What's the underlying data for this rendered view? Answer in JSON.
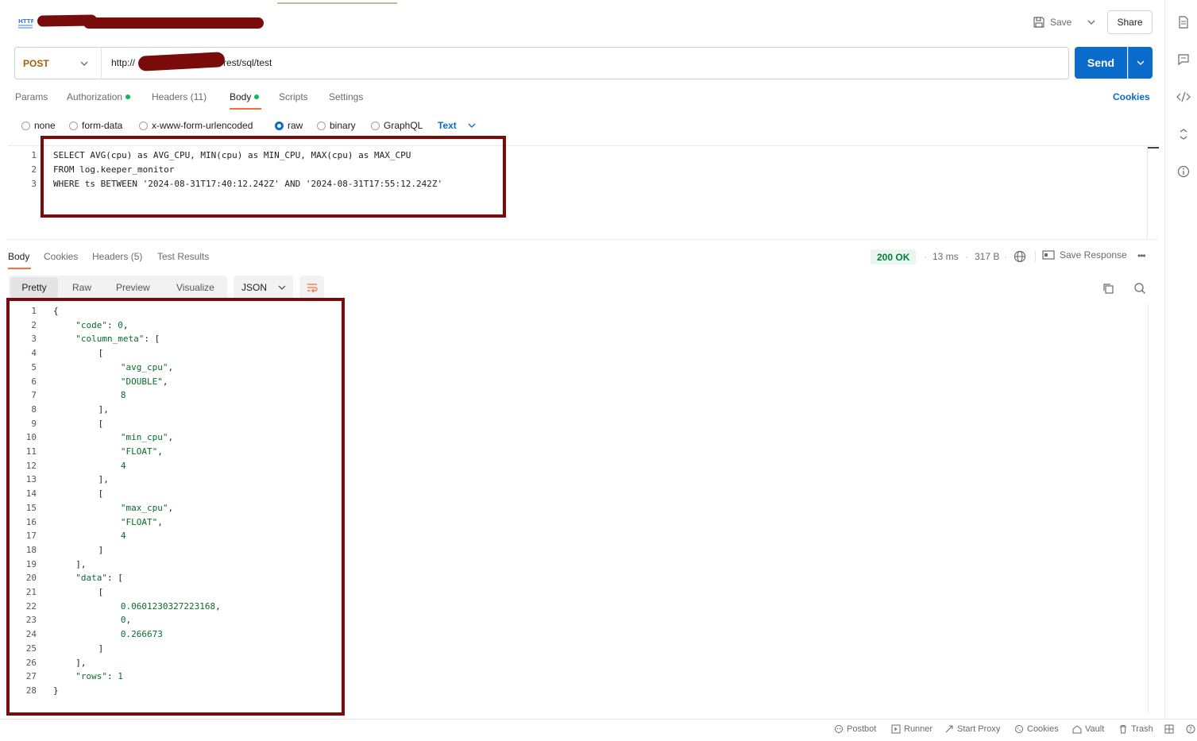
{
  "header": {
    "title_icon": "http-icon",
    "save_label": "Save",
    "share_label": "Share"
  },
  "request": {
    "method": "POST",
    "url_prefix": "http://",
    "url_suffix": "rest/sql/test",
    "send_label": "Send",
    "tabs": [
      {
        "label": "Params"
      },
      {
        "label": "Authorization"
      },
      {
        "label": "Headers (11)"
      },
      {
        "label": "Body"
      },
      {
        "label": "Scripts"
      },
      {
        "label": "Settings"
      }
    ],
    "cookies_label": "Cookies",
    "body_types": [
      {
        "label": "none"
      },
      {
        "label": "form-data"
      },
      {
        "label": "x-www-form-urlencoded"
      },
      {
        "label": "raw"
      },
      {
        "label": "binary"
      },
      {
        "label": "GraphQL"
      }
    ],
    "body_format": "Text",
    "code_lines": [
      {
        "n": "1",
        "text": "SELECT AVG(cpu) as AVG_CPU, MIN(cpu) as MIN_CPU, MAX(cpu) as MAX_CPU"
      },
      {
        "n": "2",
        "text": "FROM log.keeper_monitor"
      },
      {
        "n": "3",
        "text": "WHERE ts BETWEEN '2024-08-31T17:40:12.242Z' AND '2024-08-31T17:55:12.242Z'"
      }
    ]
  },
  "response": {
    "tabs": [
      {
        "label": "Body"
      },
      {
        "label": "Cookies"
      },
      {
        "label": "Headers (5)"
      },
      {
        "label": "Test Results"
      }
    ],
    "status": "200 OK",
    "time": "13 ms",
    "size": "317 B",
    "save_response_label": "Save Response",
    "views": [
      {
        "label": "Pretty"
      },
      {
        "label": "Raw"
      },
      {
        "label": "Preview"
      },
      {
        "label": "Visualize"
      }
    ],
    "format": "JSON",
    "lines": [
      {
        "n": "1",
        "indent": 0,
        "key": "",
        "punct": "{",
        "val": ""
      },
      {
        "n": "2",
        "indent": 1,
        "key": "\"code\"",
        "punct": ": ",
        "val": "0",
        "tail": ","
      },
      {
        "n": "3",
        "indent": 1,
        "key": "\"column_meta\"",
        "punct": ": [",
        "val": ""
      },
      {
        "n": "4",
        "indent": 2,
        "key": "",
        "punct": "[",
        "val": ""
      },
      {
        "n": "5",
        "indent": 3,
        "key": "",
        "punct": "",
        "val": "\"avg_cpu\"",
        "tail": ","
      },
      {
        "n": "6",
        "indent": 3,
        "key": "",
        "punct": "",
        "val": "\"DOUBLE\"",
        "tail": ","
      },
      {
        "n": "7",
        "indent": 3,
        "key": "",
        "punct": "",
        "val": "8"
      },
      {
        "n": "8",
        "indent": 2,
        "key": "",
        "punct": "],",
        "val": ""
      },
      {
        "n": "9",
        "indent": 2,
        "key": "",
        "punct": "[",
        "val": ""
      },
      {
        "n": "10",
        "indent": 3,
        "key": "",
        "punct": "",
        "val": "\"min_cpu\"",
        "tail": ","
      },
      {
        "n": "11",
        "indent": 3,
        "key": "",
        "punct": "",
        "val": "\"FLOAT\"",
        "tail": ","
      },
      {
        "n": "12",
        "indent": 3,
        "key": "",
        "punct": "",
        "val": "4"
      },
      {
        "n": "13",
        "indent": 2,
        "key": "",
        "punct": "],",
        "val": ""
      },
      {
        "n": "14",
        "indent": 2,
        "key": "",
        "punct": "[",
        "val": ""
      },
      {
        "n": "15",
        "indent": 3,
        "key": "",
        "punct": "",
        "val": "\"max_cpu\"",
        "tail": ","
      },
      {
        "n": "16",
        "indent": 3,
        "key": "",
        "punct": "",
        "val": "\"FLOAT\"",
        "tail": ","
      },
      {
        "n": "17",
        "indent": 3,
        "key": "",
        "punct": "",
        "val": "4"
      },
      {
        "n": "18",
        "indent": 2,
        "key": "",
        "punct": "]",
        "val": ""
      },
      {
        "n": "19",
        "indent": 1,
        "key": "",
        "punct": "],",
        "val": ""
      },
      {
        "n": "20",
        "indent": 1,
        "key": "\"data\"",
        "punct": ": [",
        "val": ""
      },
      {
        "n": "21",
        "indent": 2,
        "key": "",
        "punct": "[",
        "val": ""
      },
      {
        "n": "22",
        "indent": 3,
        "key": "",
        "punct": "",
        "val": "0.0601230327223168",
        "tail": ","
      },
      {
        "n": "23",
        "indent": 3,
        "key": "",
        "punct": "",
        "val": "0",
        "tail": ","
      },
      {
        "n": "24",
        "indent": 3,
        "key": "",
        "punct": "",
        "val": "0.266673"
      },
      {
        "n": "25",
        "indent": 2,
        "key": "",
        "punct": "]",
        "val": ""
      },
      {
        "n": "26",
        "indent": 1,
        "key": "",
        "punct": "],",
        "val": ""
      },
      {
        "n": "27",
        "indent": 1,
        "key": "\"rows\"",
        "punct": ": ",
        "val": "1"
      },
      {
        "n": "28",
        "indent": 0,
        "key": "",
        "punct": "}",
        "val": ""
      }
    ]
  },
  "statusbar": {
    "items": [
      {
        "label": "Postbot",
        "icon": "postbot-icon"
      },
      {
        "label": "Runner",
        "icon": "runner-icon"
      },
      {
        "label": "Start Proxy",
        "icon": "proxy-icon"
      },
      {
        "label": "Cookies",
        "icon": "cookie-icon"
      },
      {
        "label": "Vault",
        "icon": "vault-icon"
      },
      {
        "label": "Trash",
        "icon": "trash-icon"
      }
    ]
  },
  "colors": {
    "accent": "#0b6bcb",
    "method": "#a0620a",
    "tab_indicator": "#ff6c37",
    "status_ok": "#0a7a3a",
    "highlight_box": "#7a0b0b",
    "json_value": "#0a6b2c"
  }
}
